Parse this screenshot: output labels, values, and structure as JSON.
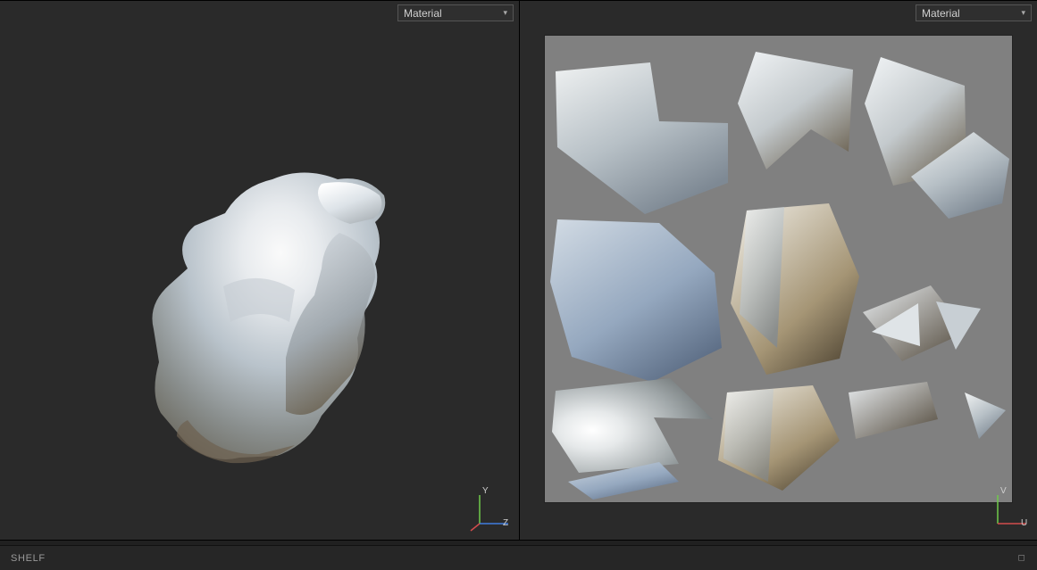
{
  "viewports": {
    "left": {
      "shading_dropdown": "Material",
      "axes": {
        "vertical": "Y",
        "horizontal": "Z"
      }
    },
    "right": {
      "shading_dropdown": "Material",
      "axes": {
        "vertical": "V",
        "horizontal": "U"
      }
    }
  },
  "shelf": {
    "label": "SHELF"
  },
  "colors": {
    "panel_bg": "#2a2a2a",
    "uv_bg": "#808080",
    "axis_y": "#6fca4a",
    "axis_z": "#3f7de0",
    "axis_x": "#d24c4c"
  }
}
